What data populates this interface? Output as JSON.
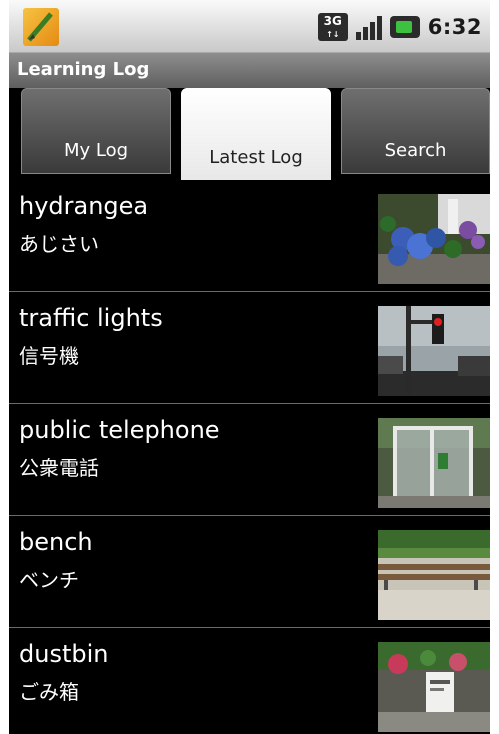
{
  "status_bar": {
    "network_label": "3G",
    "clock": "6:32"
  },
  "app": {
    "title": "Learning Log"
  },
  "tabs": [
    {
      "label": "My Log",
      "active": false
    },
    {
      "label": "Latest Log",
      "active": true
    },
    {
      "label": "Search",
      "active": false
    }
  ],
  "items": [
    {
      "en": "hydrangea",
      "ja": "あじさい",
      "thumb_icon": "hydrangea-photo"
    },
    {
      "en": "traffic lights",
      "ja": "信号機",
      "thumb_icon": "traffic-lights-photo"
    },
    {
      "en": "public  telephone",
      "ja": "公衆電話",
      "thumb_icon": "public-telephone-photo"
    },
    {
      "en": "bench",
      "ja": "ベンチ",
      "thumb_icon": "bench-photo"
    },
    {
      "en": "dustbin",
      "ja": "ごみ箱",
      "thumb_icon": "dustbin-photo"
    }
  ],
  "colors": {
    "background": "#000000",
    "title_bar": "#6e6e6e",
    "active_tab": "#ffffff",
    "divider": "#6a6a6a"
  }
}
